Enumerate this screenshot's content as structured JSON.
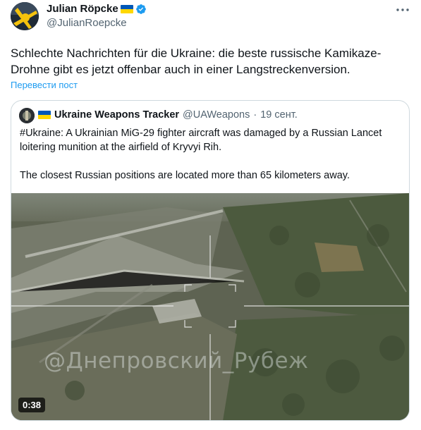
{
  "author": {
    "display_name": "Julian Röpcke",
    "handle": "@JulianRoepcke",
    "flag_icon": "ukraine-flag-icon",
    "verified_icon": "verified-badge-icon"
  },
  "tweet": {
    "text": "Schlechte Nachrichten für die Ukraine: die beste russische Kamikaze-Drohne gibt es jetzt offenbar auch in einer Langstreckenversion.",
    "translate_label": "Перевести пост"
  },
  "quoted": {
    "display_name": "Ukraine Weapons Tracker",
    "handle": "@UAWeapons",
    "separator": "·",
    "date": "19 сент.",
    "paragraph_1": "#Ukraine: A Ukrainian MiG-29 fighter aircraft was damaged by a Russian Lancet loitering munition at the airfield of Kryvyi Rih.",
    "paragraph_2": "The closest Russian positions are located more than 65 kilometers away.",
    "media": {
      "watermark": "@Днепровский_Рубеж",
      "duration": "0:38"
    }
  },
  "colors": {
    "accent": "#1d9bf0",
    "text": "#0f1419",
    "secondary": "#536471",
    "border": "#cfd9de"
  }
}
